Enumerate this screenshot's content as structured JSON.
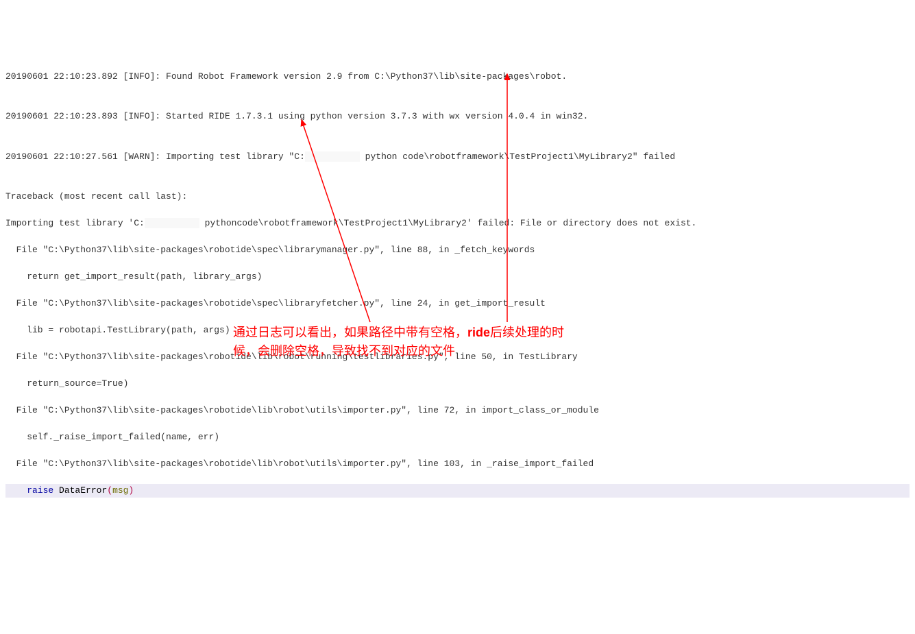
{
  "log": {
    "l1": "20190601 22:10:23.892 [INFO]: Found Robot Framework version 2.9 from C:\\Python37\\lib\\site-packages\\robot.",
    "l2": "",
    "l3_a": "20190601 22:10:23.893 [INFO]: Started RIDE 1.7.3.1 using python version 3.7.3 with wx version 4.0.4 in win32.",
    "l4": "",
    "l5_a": "20190601 22:10:27.561 [WARN]: Importing test library \"C:",
    "l5_b": " python code\\robotframework\\TestProject1\\MyLibrary2\" failed",
    "l6": "",
    "l7": "Traceback (most recent call last):",
    "l8_a": "Importing test library 'C:",
    "l8_b": " pythoncode\\robotframework\\TestProject1\\MyLibrary2' failed: File or directory does not exist.",
    "l9": "  File \"C:\\Python37\\lib\\site-packages\\robotide\\spec\\librarymanager.py\", line 88, in _fetch_keywords",
    "l10": "    return get_import_result(path, library_args)",
    "l11": "  File \"C:\\Python37\\lib\\site-packages\\robotide\\spec\\libraryfetcher.py\", line 24, in get_import_result",
    "l12": "    lib = robotapi.TestLibrary(path, args)",
    "l13": "  File \"C:\\Python37\\lib\\site-packages\\robotide\\lib\\robot\\running\\testlibraries.py\", line 50, in TestLibrary",
    "l14": "    return_source=True)",
    "l15": "  File \"C:\\Python37\\lib\\site-packages\\robotide\\lib\\robot\\utils\\importer.py\", line 72, in import_class_or_module",
    "l16": "    self._raise_import_failed(name, err)",
    "l17": "  File \"C:\\Python37\\lib\\site-packages\\robotide\\lib\\robot\\utils\\importer.py\", line 103, in _raise_import_failed",
    "l18_indent": "    ",
    "l18_raise": "raise ",
    "l18_id": "DataError",
    "l18_lp": "(",
    "l18_arg": "msg",
    "l18_rp": ")"
  },
  "annotation": {
    "line1_a": "通过日志可以看出，如果路径中带有空格，",
    "line1_b": "ride",
    "line1_c": "后续处理的时",
    "line2": "候，会删除空格，导致找不到对应的文件"
  }
}
